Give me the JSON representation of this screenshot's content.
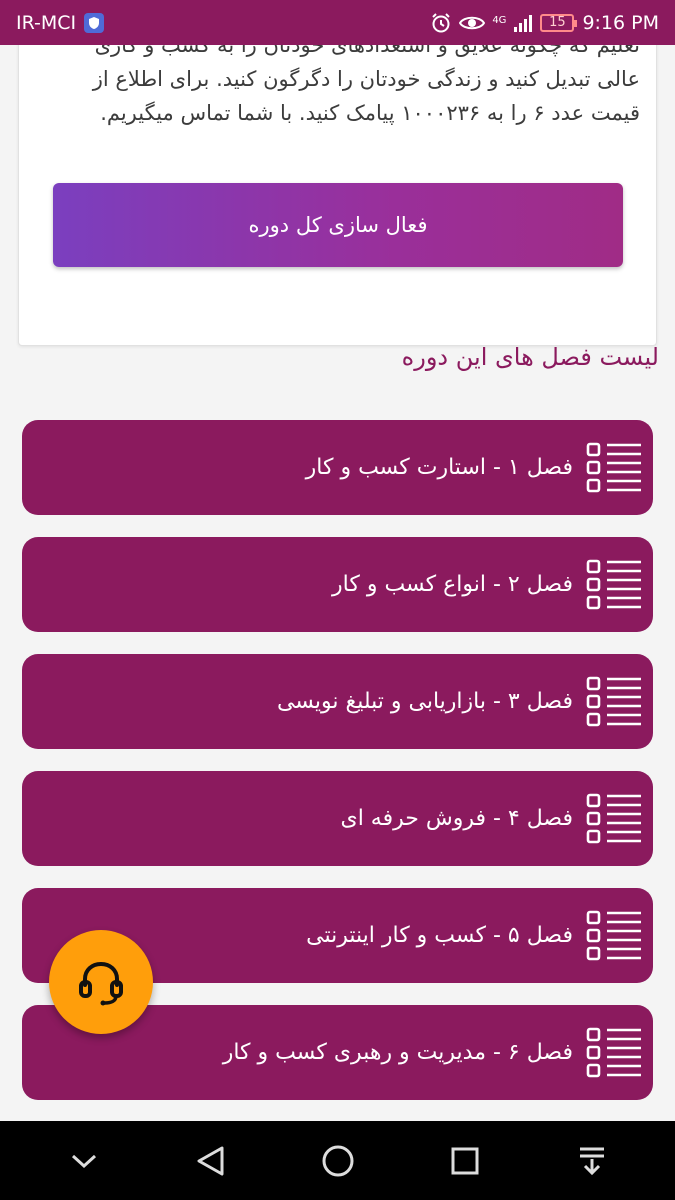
{
  "status_bar": {
    "carrier": "IR-MCI",
    "battery": "15",
    "time": "9:16 PM",
    "network": "4G"
  },
  "card": {
    "description": "تعلیم که چگونه علایق و استعدادهای خودتان را به کسب و کاری عالی تبدیل کنید و زندگی خودتان را دگرگون کنید. برای اطلاع از قیمت عدد ۶ را به ۱۰۰۰۲۳۶ پیامک کنید. با شما تماس میگیریم.",
    "activate_label": "فعال سازی کل دوره"
  },
  "section_title": "لیست فصل های این دوره",
  "chapters": [
    {
      "label": "فصل ۱ - استارت کسب و کار"
    },
    {
      "label": "فصل ۲ - انواع کسب و کار"
    },
    {
      "label": "فصل ۳ - بازاریابی و تبلیغ نویسی"
    },
    {
      "label": "فصل ۴ - فروش حرفه ای"
    },
    {
      "label": "فصل ۵ - کسب و کار اینترنتی"
    },
    {
      "label": "فصل ۶ - مدیریت و رهبری کسب و کار"
    }
  ],
  "icons": {
    "chapter_icon": "list-icon",
    "fab_icon": "headset-icon",
    "nav": [
      "chevron-down-icon",
      "back-icon",
      "home-icon",
      "recents-icon",
      "notification-pulldown-icon"
    ]
  },
  "colors": {
    "primary": "#8b1a5e",
    "fab": "#ff9e0b",
    "button_gradient_start": "#7b3fbf",
    "button_gradient_end": "#a02c86"
  }
}
